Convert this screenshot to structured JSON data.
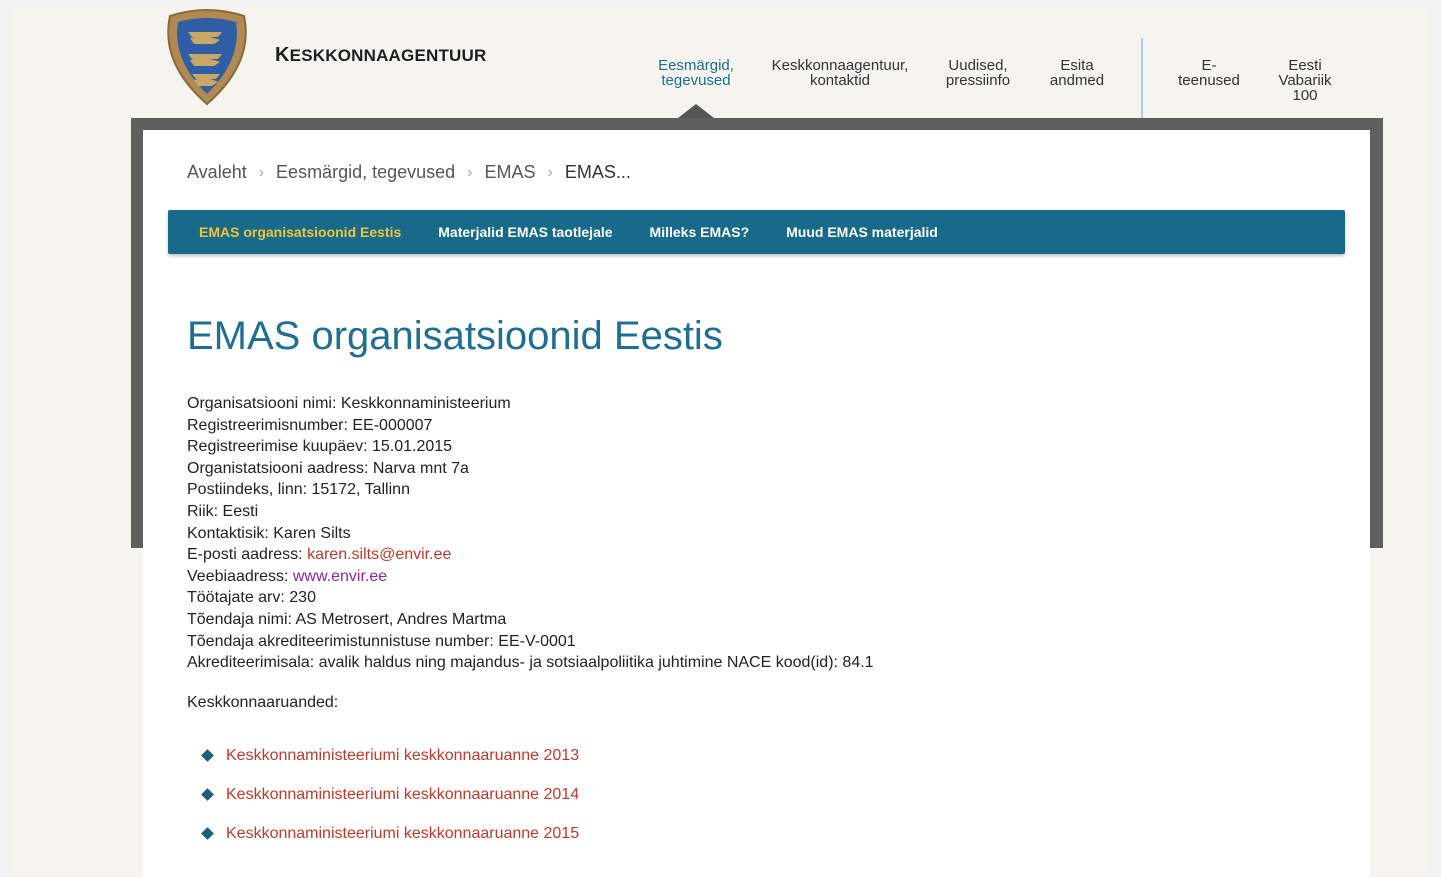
{
  "header": {
    "brand": "Keskkonnaagentuur",
    "nav": [
      {
        "label_1": "Eesmärgid,",
        "label_2": "tegevused",
        "label_3": ""
      },
      {
        "label_1": "Keskkonnaagentuur,",
        "label_2": "kontaktid",
        "label_3": ""
      },
      {
        "label_1": "Uudised,",
        "label_2": "pressiinfo",
        "label_3": ""
      },
      {
        "label_1": "Esita",
        "label_2": "andmed",
        "label_3": ""
      },
      {
        "label_1": "E-",
        "label_2": "teenused",
        "label_3": ""
      },
      {
        "label_1": "Eesti",
        "label_2": "Vabariik",
        "label_3": "100"
      }
    ]
  },
  "breadcrumb": [
    "Avaleht",
    "Eesmärgid, tegevused",
    "EMAS",
    "EMAS..."
  ],
  "subnav": [
    "EMAS organisatsioonid Eestis",
    "Materjalid EMAS taotlejale",
    "Milleks EMAS?",
    "Muud EMAS materjalid"
  ],
  "page_title": "EMAS organisatsioonid Eestis",
  "details": {
    "org_name": "Organisatsiooni nimi: Keskkonnaministeerium",
    "reg_number": "Registreerimisnumber: EE-000007",
    "reg_date": "Registreerimise kuupäev: 15.01.2015",
    "address": "Organistatsiooni aadress: Narva mnt 7a",
    "postal": "Postiindeks, linn: 15172, Tallinn",
    "country": "Riik: Eesti",
    "contact": "Kontaktisik: Karen Silts",
    "email_label": "E-posti aadress: ",
    "email": "karen.silts@envir.ee",
    "web_label": "Veebiaadress: ",
    "web": "www.envir.ee",
    "employees": "Töötajate arv: 230",
    "verifier": "Tõendaja nimi: AS Metrosert, Andres Martma",
    "accreditation": "Tõendaja akrediteerimistunnistuse number: EE-V-0001",
    "scope": "Akrediteerimisala: avalik haldus ning majandus- ja sotsiaalpoliitika juhtimine NACE kood(id): 84.1"
  },
  "reports_label": "Keskkonnaaruanded:",
  "reports": [
    "Keskkonnaministeeriumi keskkonnaaruanne 2013",
    "Keskkonnaministeeriumi keskkonnaaruanne 2014",
    "Keskkonnaministeeriumi keskkonnaaruanne 2015"
  ],
  "colors": {
    "accent": "#1f6f90",
    "subnav_bg": "#176a89",
    "subnav_active": "#f0c33c",
    "link": "#c0392b",
    "visited_link": "#8e24aa"
  }
}
